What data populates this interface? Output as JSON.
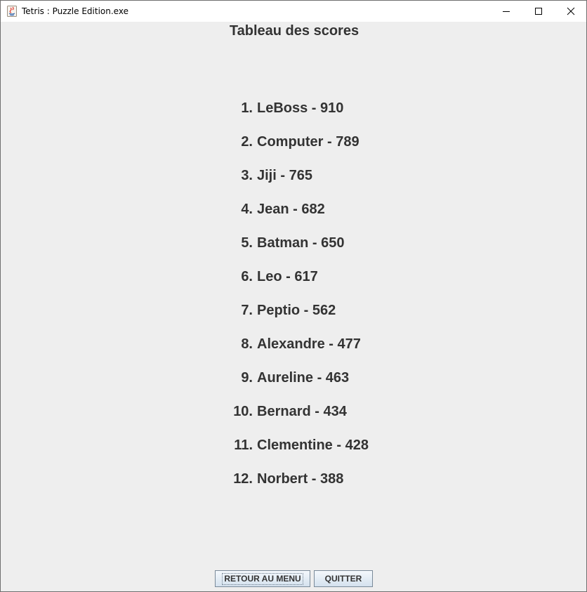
{
  "window": {
    "title": "Tetris : Puzzle Edition.exe",
    "icon": "java-icon"
  },
  "board": {
    "title": "Tableau des scores",
    "scores": [
      {
        "rank": "1.",
        "entry": "LeBoss - 910"
      },
      {
        "rank": "2.",
        "entry": "Computer - 789"
      },
      {
        "rank": "3.",
        "entry": "Jiji - 765"
      },
      {
        "rank": "4.",
        "entry": "Jean - 682"
      },
      {
        "rank": "5.",
        "entry": "Batman - 650"
      },
      {
        "rank": "6.",
        "entry": "Leo - 617"
      },
      {
        "rank": "7.",
        "entry": "Peptio - 562"
      },
      {
        "rank": "8.",
        "entry": "Alexandre - 477"
      },
      {
        "rank": "9.",
        "entry": "Aureline - 463"
      },
      {
        "rank": "10.",
        "entry": "Bernard - 434"
      },
      {
        "rank": "11.",
        "entry": "Clementine - 428"
      },
      {
        "rank": "12.",
        "entry": "Norbert - 388"
      }
    ]
  },
  "buttons": {
    "menu_label": "RETOUR AU MENU",
    "quit_label": "QUITTER"
  }
}
